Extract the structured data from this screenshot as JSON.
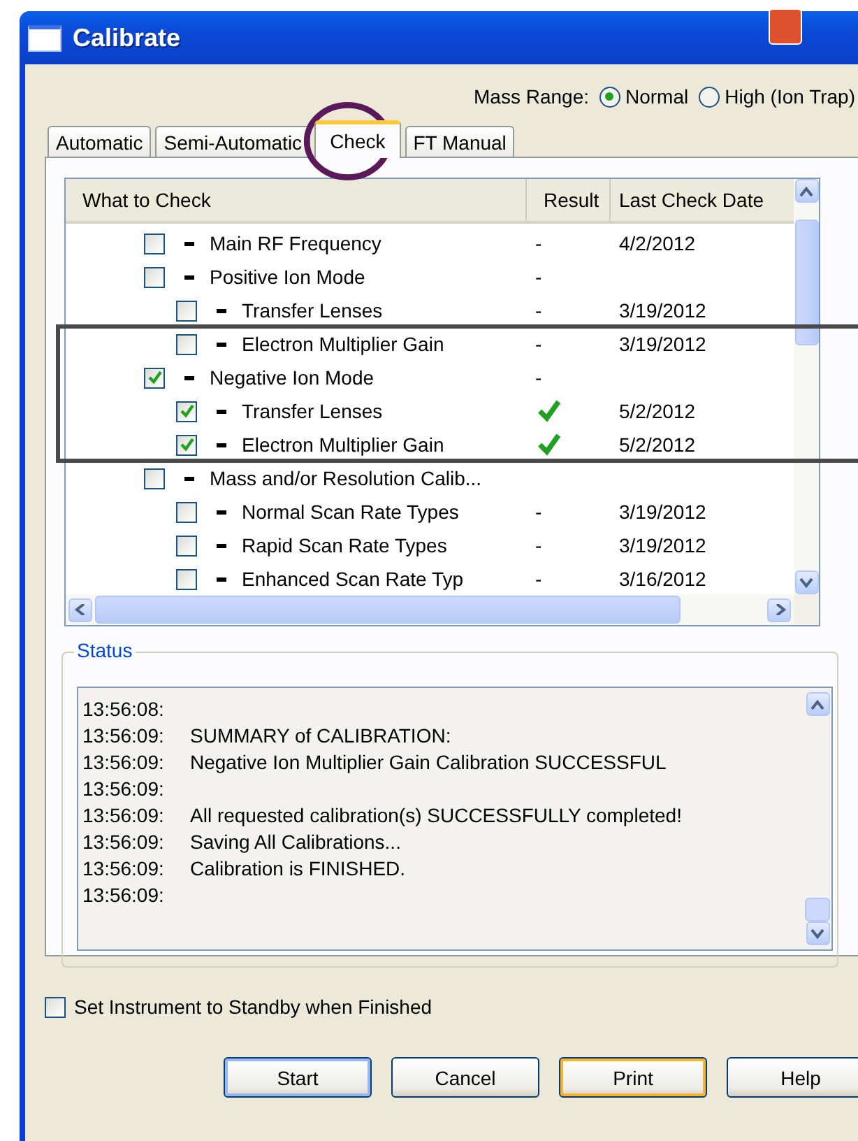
{
  "window": {
    "title": "Calibrate"
  },
  "mass_range": {
    "label": "Mass Range:",
    "options": [
      {
        "label": "Normal",
        "selected": true
      },
      {
        "label": "High (Ion Trap)",
        "selected": false
      }
    ]
  },
  "tabs": [
    {
      "label": "Automatic",
      "selected": false
    },
    {
      "label": "Semi-Automatic",
      "selected": false
    },
    {
      "label": "Check",
      "selected": true
    },
    {
      "label": "FT Manual",
      "selected": false
    }
  ],
  "check_list": {
    "columns": [
      "What to Check",
      "Result",
      "Last Check Date"
    ],
    "items": [
      {
        "label": "Main RF Frequency",
        "checked": false,
        "result": {
          "kind": "dash",
          "text": "-"
        },
        "date": "4/2/2012"
      },
      {
        "label": "Positive Ion Mode",
        "checked": false,
        "result": {
          "kind": "dash",
          "text": "-"
        },
        "children": [
          {
            "label": "Transfer Lenses",
            "checked": false,
            "result": {
              "kind": "dash",
              "text": "-"
            },
            "date": "3/19/2012"
          },
          {
            "label": "Electron Multiplier Gain",
            "checked": false,
            "result": {
              "kind": "dash",
              "text": "-"
            },
            "date": "3/19/2012"
          }
        ]
      },
      {
        "label": "Negative Ion Mode",
        "checked": true,
        "result": {
          "kind": "dash",
          "text": "-"
        },
        "children": [
          {
            "label": "Transfer Lenses",
            "checked": true,
            "result": {
              "kind": "check"
            },
            "date": "5/2/2012"
          },
          {
            "label": "Electron Multiplier Gain",
            "checked": true,
            "result": {
              "kind": "check"
            },
            "date": "5/2/2012"
          }
        ]
      },
      {
        "label": "Mass and/or Resolution Calib...",
        "checked": false,
        "children": [
          {
            "label": "Normal Scan Rate Types",
            "checked": false,
            "result": {
              "kind": "dash",
              "text": "-"
            },
            "date": "3/19/2012"
          },
          {
            "label": "Rapid Scan Rate Types",
            "checked": false,
            "result": {
              "kind": "dash",
              "text": "-"
            },
            "date": "3/19/2012"
          },
          {
            "label": "Enhanced Scan Rate Typ",
            "checked": false,
            "result": {
              "kind": "dash",
              "text": "-"
            },
            "date": "3/16/2012"
          }
        ]
      }
    ]
  },
  "status": {
    "title": "Status",
    "lines": [
      {
        "time": "13:56:08:"
      },
      {
        "time": "13:56:09:",
        "message": "SUMMARY of CALIBRATION:"
      },
      {
        "time": "13:56:09:",
        "message": "Negative Ion Multiplier Gain Calibration SUCCESSFUL"
      },
      {
        "time": "13:56:09:"
      },
      {
        "time": "13:56:09:",
        "message": "All requested calibration(s) SUCCESSFULLY completed!"
      },
      {
        "time": "13:56:09:",
        "message": "Saving All Calibrations..."
      },
      {
        "time": "13:56:09:",
        "message": "Calibration is FINISHED."
      },
      {
        "time": "13:56:09:"
      }
    ]
  },
  "standby": {
    "label": "Set Instrument to Standby when Finished",
    "checked": false
  },
  "buttons": [
    {
      "label": "Start",
      "focused": true,
      "hot": false
    },
    {
      "label": "Cancel",
      "focused": false,
      "hot": false
    },
    {
      "label": "Print",
      "focused": false,
      "hot": true
    },
    {
      "label": "Help",
      "focused": false,
      "hot": false
    }
  ]
}
